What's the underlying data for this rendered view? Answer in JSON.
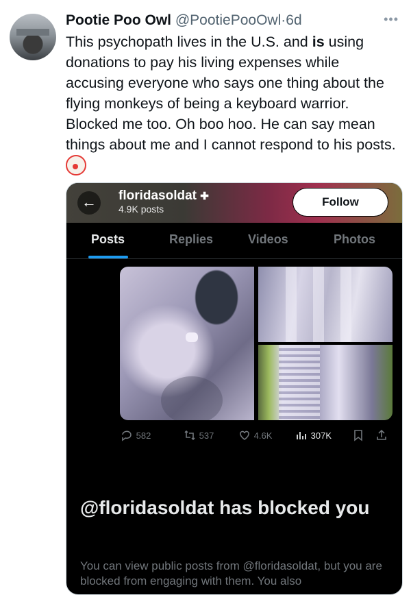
{
  "tweet": {
    "author_name": "Pootie Poo Owl",
    "handle": "@PootiePooOwl",
    "separator": "·",
    "time": "6d",
    "more": "•••",
    "text_before_bold": "This psychopath lives in the U.S. and ",
    "text_bold": "is",
    "text_after_bold": " using donations to pay his living expenses while accusing everyone who says one thing about the flying monkeys of being a keyboard warrior. Blocked me too. Oh boo hoo. He can say mean things about me and I cannot respond to his posts.",
    "emoji": "clown-face-emoji"
  },
  "screenshot": {
    "back_icon": "←",
    "account_name": "floridasoldat",
    "verified_badge": "✚",
    "posts_count": "4.9K posts",
    "follow_label": "Follow",
    "tabs": [
      {
        "label": "Posts",
        "active": true
      },
      {
        "label": "Replies",
        "active": false
      },
      {
        "label": "Videos",
        "active": false
      },
      {
        "label": "Photos",
        "active": false
      }
    ],
    "actions": {
      "replies": "582",
      "reposts": "537",
      "likes": "4.6K",
      "views": "307K"
    },
    "blocked_title": "@floridasoldat has blocked you",
    "blocked_text": "You can view public posts from @floridasoldat, but you are blocked from engaging with them. You also"
  },
  "colors": {
    "accent": "#1d9bf0",
    "text_dark": "#0f1419",
    "muted": "#536471"
  }
}
